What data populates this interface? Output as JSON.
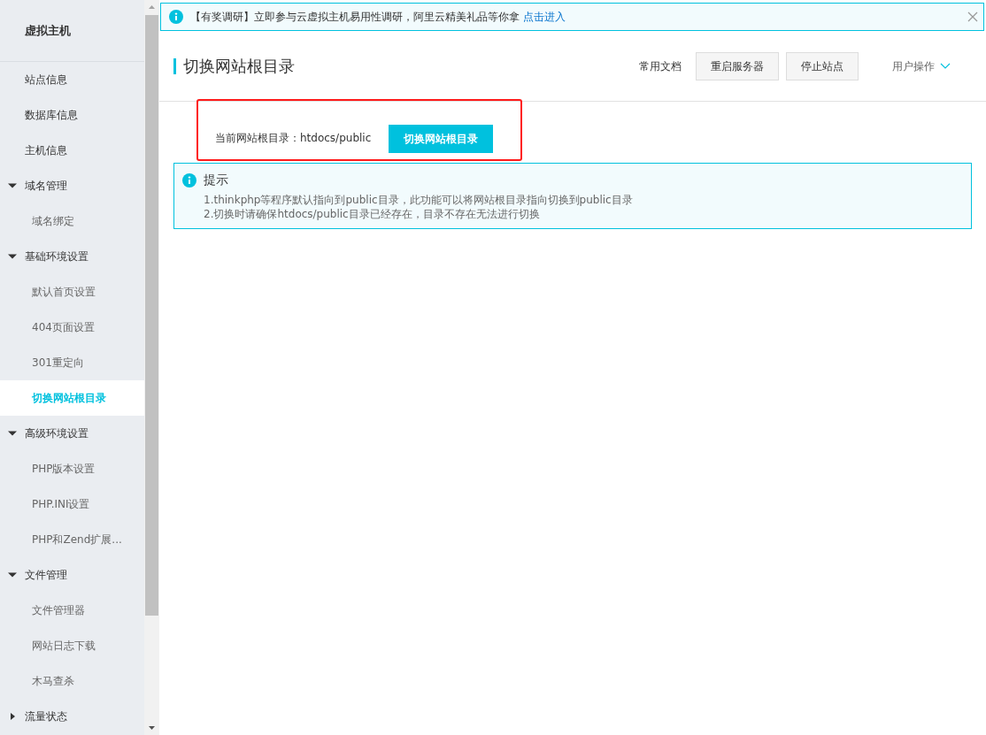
{
  "sidebar": {
    "title": "虚拟主机",
    "items": [
      {
        "kind": "link",
        "label": "站点信息",
        "selected": false
      },
      {
        "kind": "link",
        "label": "数据库信息",
        "selected": false
      },
      {
        "kind": "link",
        "label": "主机信息",
        "selected": false
      },
      {
        "kind": "group",
        "label": "域名管理",
        "expanded": true,
        "children": [
          {
            "label": "域名绑定",
            "selected": false
          }
        ]
      },
      {
        "kind": "group",
        "label": "基础环境设置",
        "expanded": true,
        "children": [
          {
            "label": "默认首页设置",
            "selected": false
          },
          {
            "label": "404页面设置",
            "selected": false
          },
          {
            "label": "301重定向",
            "selected": false
          },
          {
            "label": "切换网站根目录",
            "selected": true
          }
        ]
      },
      {
        "kind": "group",
        "label": "高级环境设置",
        "expanded": true,
        "children": [
          {
            "label": "PHP版本设置",
            "selected": false
          },
          {
            "label": "PHP.INI设置",
            "selected": false
          },
          {
            "label": "PHP和Zend扩展...",
            "selected": false
          }
        ]
      },
      {
        "kind": "group",
        "label": "文件管理",
        "expanded": true,
        "children": [
          {
            "label": "文件管理器",
            "selected": false
          },
          {
            "label": "网站日志下载",
            "selected": false
          },
          {
            "label": "木马查杀",
            "selected": false
          }
        ]
      },
      {
        "kind": "group",
        "label": "流量状态",
        "expanded": false
      }
    ]
  },
  "notice": {
    "text": "【有奖调研】立即参与云虚拟主机易用性调研，阿里云精美礼品等你拿",
    "link": "点击进入"
  },
  "header": {
    "title": "切换网站根目录",
    "docs_link": "常用文档",
    "buttons": [
      "重启服务器",
      "停止站点"
    ],
    "user_menu": "用户操作"
  },
  "root_dir": {
    "label": "当前网站根目录：htdocs/public",
    "button": "切换网站根目录"
  },
  "tip": {
    "title": "提示",
    "lines": [
      "1.thinkphp等程序默认指向到public目录，此功能可以将网站根目录指向切换到public目录",
      "2.切换时请确保htdocs/public目录已经存在，目录不存在无法进行切换"
    ]
  }
}
